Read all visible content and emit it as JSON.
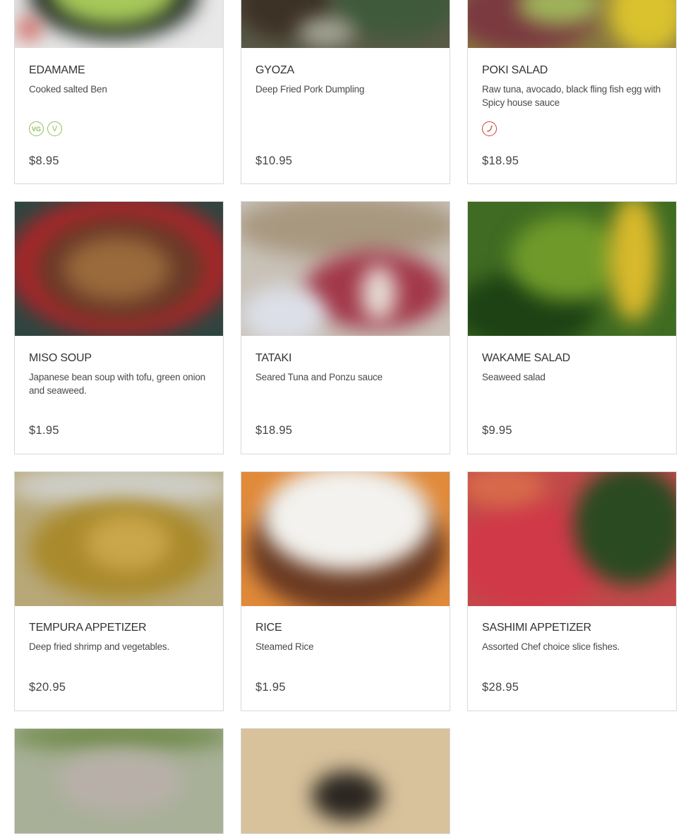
{
  "menu": {
    "items": [
      {
        "name": "EDAMAME",
        "description": "Cooked salted Ben",
        "price": "$8.95",
        "badges": [
          "VG",
          "V"
        ]
      },
      {
        "name": "GYOZA",
        "description": "Deep Fried Pork Dumpling",
        "price": "$10.95",
        "badges": []
      },
      {
        "name": "POKI SALAD",
        "description": "Raw tuna, avocado, black fling fish egg with Spicy house sauce",
        "price": "$18.95",
        "badges": [
          "spicy"
        ]
      },
      {
        "name": "MISO SOUP",
        "description": "Japanese bean soup with tofu, green onion and seaweed.",
        "price": "$1.95",
        "badges": []
      },
      {
        "name": "TATAKI",
        "description": "Seared Tuna and Ponzu sauce",
        "price": "$18.95",
        "badges": []
      },
      {
        "name": "WAKAME SALAD",
        "description": "Seaweed salad",
        "price": "$9.95",
        "badges": []
      },
      {
        "name": "TEMPURA APPETIZER",
        "description": "Deep fried shrimp and vegetables.",
        "price": "$20.95",
        "badges": []
      },
      {
        "name": "RICE",
        "description": "Steamed Rice",
        "price": "$1.95",
        "badges": []
      },
      {
        "name": "SASHIMI APPETIZER",
        "description": "Assorted Chef choice slice fishes.",
        "price": "$28.95",
        "badges": []
      }
    ],
    "badge_labels": {
      "vegan": "VG",
      "vegetarian": "V"
    },
    "icons": {
      "vegan": "vegan-badge-icon",
      "vegetarian": "vegetarian-badge-icon",
      "spicy": "chili-pepper-icon"
    },
    "colors": {
      "badge_green": "#8fbf5a",
      "badge_red": "#c9432f",
      "border": "#d9d9d9"
    }
  }
}
